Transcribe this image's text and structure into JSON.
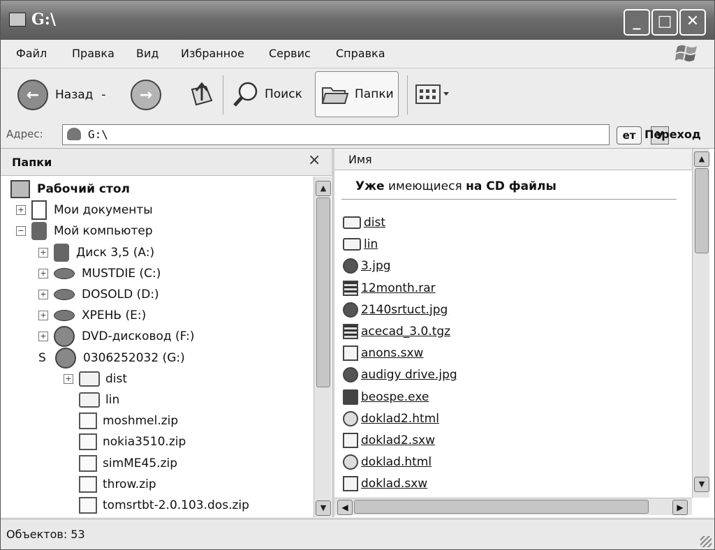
{
  "window": {
    "title": "G:\\"
  },
  "menu": [
    "Файл",
    "Правка",
    "Вид",
    "Избранное",
    "Сервис",
    "Справка"
  ],
  "toolbar": {
    "back_label": "Назад",
    "back_dropdown": "-",
    "search_label": "Поиск",
    "folders_label": "Папки"
  },
  "address": {
    "label": "Адрес:",
    "value": "G:\\",
    "dropdown_text": "У",
    "go_icon_text": "ет",
    "go_label": "Переход"
  },
  "folders_pane": {
    "title": "Папки",
    "close": "×",
    "tree": [
      {
        "label": "Рабочий стол",
        "icon": "desktop-icon",
        "indent": 0,
        "toggle": "",
        "bold": true
      },
      {
        "label": "Мои документы",
        "icon": "documents-icon",
        "indent": 1,
        "toggle": "+"
      },
      {
        "label": "Мой компьютер",
        "icon": "computer-icon",
        "indent": 1,
        "toggle": "−"
      },
      {
        "label": "Диск 3,5 (A:)",
        "icon": "floppy-icon",
        "indent": 2,
        "toggle": "+"
      },
      {
        "label": "MUSTDIE (C:)",
        "icon": "drive-icon",
        "indent": 2,
        "toggle": "+"
      },
      {
        "label": "DOSOLD (D:)",
        "icon": "drive-icon",
        "indent": 2,
        "toggle": "+"
      },
      {
        "label": "ХРЕНЬ (E:)",
        "icon": "drive-icon",
        "indent": 2,
        "toggle": "+"
      },
      {
        "label": "DVD-дисковод (F:)",
        "icon": "cd-drive-icon",
        "indent": 2,
        "toggle": "+"
      },
      {
        "label": "0306252032 (G:)",
        "icon": "cd-drive-icon",
        "indent": 2,
        "toggle": "S"
      },
      {
        "label": "dist",
        "icon": "folder-icon",
        "indent": 3,
        "toggle": "+"
      },
      {
        "label": "lin",
        "icon": "folder-icon",
        "indent": 3,
        "toggle": ""
      },
      {
        "label": "moshmel.zip",
        "icon": "zip-icon",
        "indent": 3,
        "toggle": ""
      },
      {
        "label": "nokia3510.zip",
        "icon": "zip-icon",
        "indent": 3,
        "toggle": ""
      },
      {
        "label": "simME45.zip",
        "icon": "zip-icon",
        "indent": 3,
        "toggle": ""
      },
      {
        "label": "throw.zip",
        "icon": "zip-icon",
        "indent": 3,
        "toggle": ""
      },
      {
        "label": "tomsrtbt-2.0.103.dos.zip",
        "icon": "zip-icon",
        "indent": 3,
        "toggle": ""
      }
    ]
  },
  "files_pane": {
    "column_name": "Имя",
    "group": {
      "part1": "Уже",
      "part2": " имеющиеся ",
      "part3": "на CD",
      "part4": " файлы"
    },
    "files": [
      {
        "name": "dist",
        "type": "folder"
      },
      {
        "name": "lin",
        "type": "folder"
      },
      {
        "name": "3.jpg",
        "type": "image"
      },
      {
        "name": "12month.rar",
        "type": "archive"
      },
      {
        "name": "2140srtuct.jpg",
        "type": "image"
      },
      {
        "name": "acecad_3.0.tgz",
        "type": "archive"
      },
      {
        "name": "anons.sxw",
        "type": "document"
      },
      {
        "name": "audigy drive.jpg",
        "type": "image"
      },
      {
        "name": "beospe.exe",
        "type": "exe"
      },
      {
        "name": "doklad2.html",
        "type": "html"
      },
      {
        "name": "doklad2.sxw",
        "type": "document"
      },
      {
        "name": "doklad.html",
        "type": "html"
      },
      {
        "name": "doklad.sxw",
        "type": "document"
      }
    ]
  },
  "status": {
    "text": "Объектов: 53"
  }
}
